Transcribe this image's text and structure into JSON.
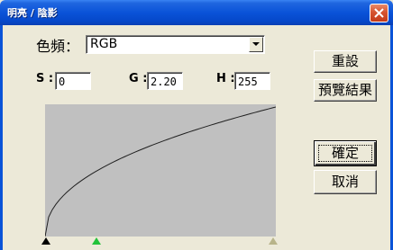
{
  "window": {
    "title": "明亮 / 陰影",
    "close_icon": "close-icon"
  },
  "channel": {
    "label": "色頻：",
    "selected": "RGB"
  },
  "fields": {
    "s_label": "S :",
    "s_value": "0",
    "g_label": "G :",
    "g_value": "2.20",
    "h_label": "H :",
    "h_value": "255"
  },
  "buttons": {
    "reset": "重設",
    "preview": "預覽結果",
    "ok": "確定",
    "cancel": "取消"
  },
  "curve": {
    "shadow": 0,
    "gamma": 2.2,
    "highlight": 255
  },
  "markers": {
    "shadow_color": "#000000",
    "gamma_color": "#22c23a",
    "highlight_color": "#b8b48a"
  }
}
